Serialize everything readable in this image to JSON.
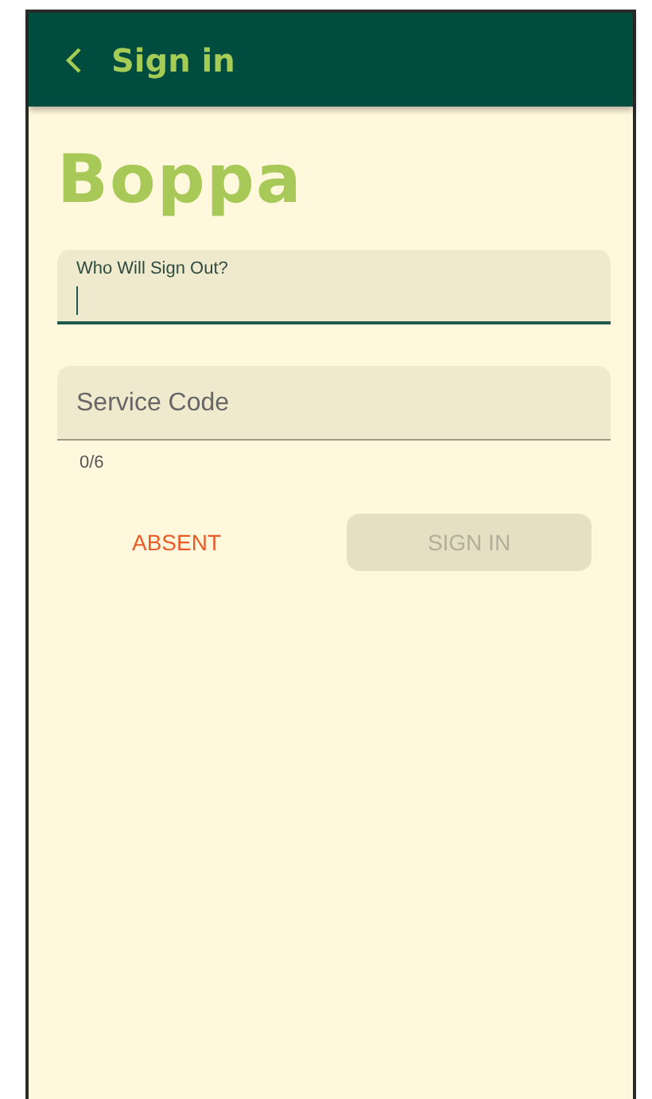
{
  "app_bar": {
    "title": "Sign in"
  },
  "brand": "Boppa",
  "fields": [
    {
      "label": "Who Will Sign Out?",
      "focused": true
    },
    {
      "placeholder": "Service Code",
      "counter": "0/6",
      "focused": false
    }
  ],
  "buttons": [
    {
      "label": "ABSENT",
      "kind": "text",
      "disabled": false
    },
    {
      "label": "SIGN IN",
      "kind": "filled",
      "disabled": true
    }
  ]
}
